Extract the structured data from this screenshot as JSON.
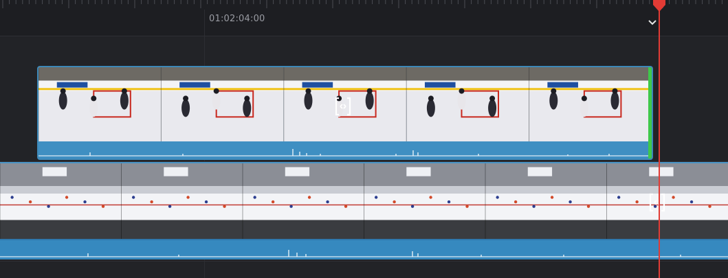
{
  "ruler": {
    "timecode": "01:02:04:00"
  },
  "colors": {
    "background": "#222327",
    "clip_border": "#3d88b8",
    "audio_blue": "#3f8fc2",
    "playhead": "#e23b35",
    "clip_end_marker": "#3ec84a",
    "waveform": "#dbeaf5"
  },
  "icons": {
    "trim_upper": "trim-slip-icon",
    "trim_lower": "trim-slip-icon",
    "snap": "chevron-down-icon",
    "playhead": "playhead-icon"
  }
}
